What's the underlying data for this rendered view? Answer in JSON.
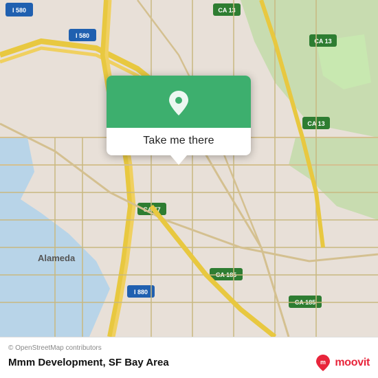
{
  "map": {
    "background_color": "#e8e0d8",
    "attribution": "© OpenStreetMap contributors"
  },
  "popup": {
    "button_label": "Take me there",
    "pin_icon": "location-pin"
  },
  "bottom_bar": {
    "attribution": "© OpenStreetMap contributors",
    "place_name": "Mmm Development, SF Bay Area",
    "logo_text": "moovit"
  }
}
